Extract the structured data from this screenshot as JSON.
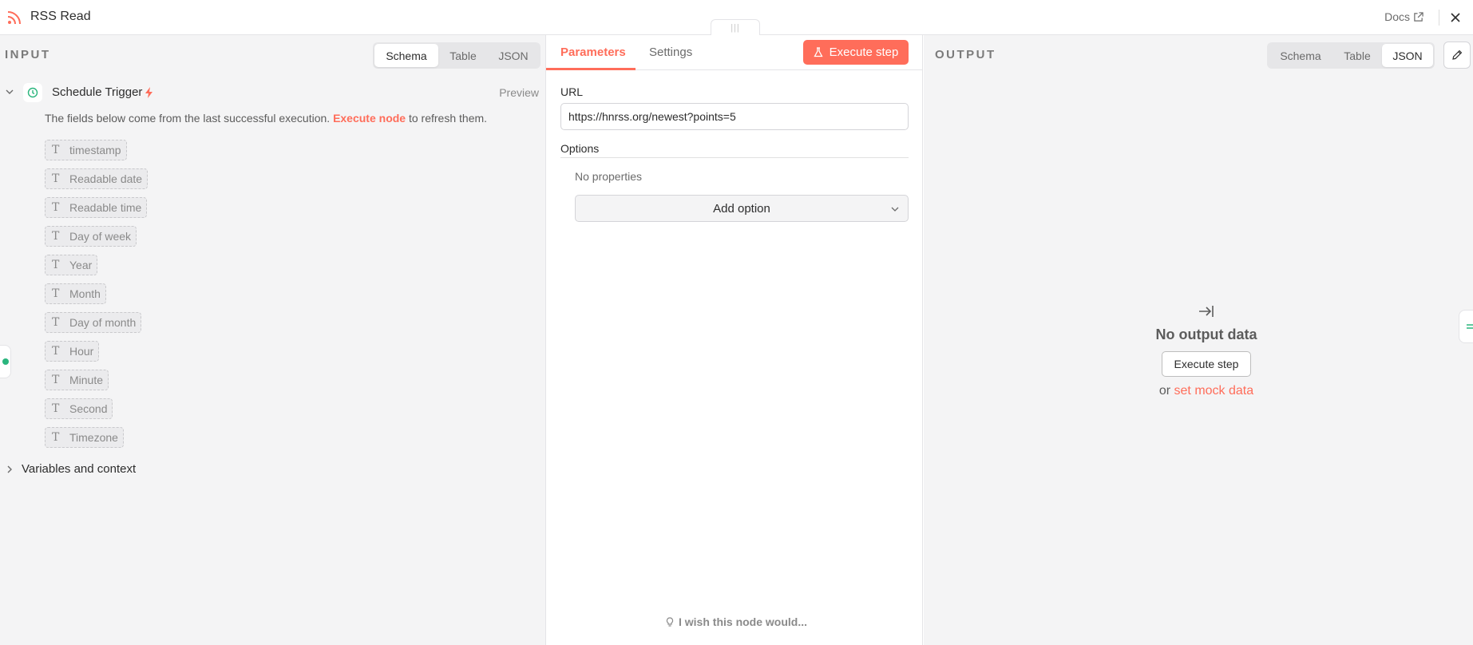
{
  "header": {
    "title": "RSS Read",
    "docs_label": "Docs",
    "handle_glyph": "|||"
  },
  "input": {
    "label": "INPUT",
    "view_tabs": [
      "Schema",
      "Table",
      "JSON"
    ],
    "active_view": "Schema",
    "trigger_name": "Schedule Trigger",
    "preview_label": "Preview",
    "notice_before": "The fields below come from the last successful execution.",
    "notice_link": "Execute node",
    "notice_after": "to refresh them.",
    "field_type_glyph": "T",
    "fields": [
      "timestamp",
      "Readable date",
      "Readable time",
      "Day of week",
      "Year",
      "Month",
      "Day of month",
      "Hour",
      "Minute",
      "Second",
      "Timezone"
    ],
    "variables_label": "Variables and context"
  },
  "params": {
    "tabs": [
      "Parameters",
      "Settings"
    ],
    "active_tab": "Parameters",
    "execute_label": "Execute step",
    "url_label": "URL",
    "url_value": "https://hnrss.org/newest?points=5",
    "options_label": "Options",
    "no_properties": "No properties",
    "add_option_label": "Add option",
    "wish_label": "I wish this node would..."
  },
  "output": {
    "label": "OUTPUT",
    "view_tabs": [
      "Schema",
      "Table",
      "JSON"
    ],
    "active_view": "JSON",
    "empty_title": "No output data",
    "execute_label": "Execute step",
    "mock_prefix": "or",
    "mock_link": "set mock data"
  },
  "colors": {
    "accent": "#ff6d5a",
    "success": "#2ab57d",
    "panel_bg": "#f4f4f5",
    "border": "#e4e4e7"
  },
  "icons": [
    "rss-icon",
    "external-link-icon",
    "close-icon",
    "chevron-down-icon",
    "clock-icon",
    "bolt-icon",
    "chevron-right-icon",
    "flask-icon",
    "lightbulb-icon",
    "arrow-to-line-icon",
    "pencil-icon"
  ]
}
